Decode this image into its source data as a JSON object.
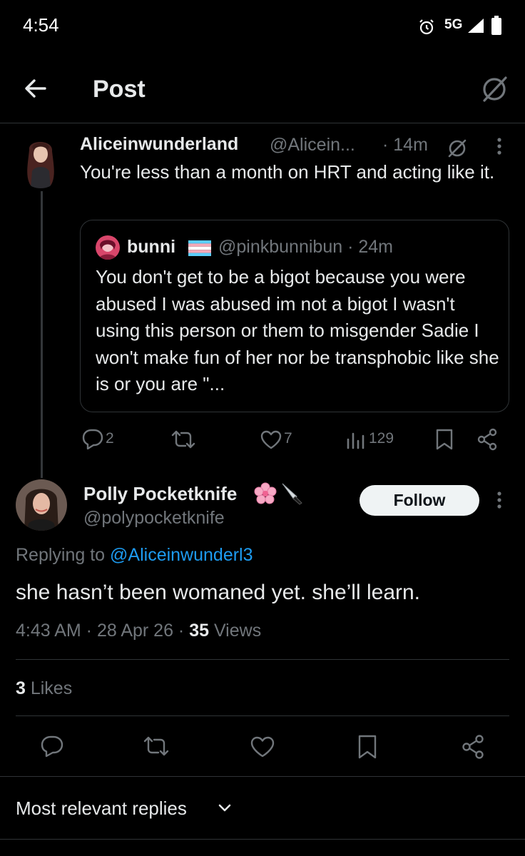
{
  "status_bar": {
    "time": "4:54",
    "network": "5G"
  },
  "header": {
    "title": "Post"
  },
  "parent_tweet": {
    "display_name": "Aliceinwunderland",
    "handle": "@Alicein...",
    "time": "· 14m",
    "text": "You're less than a month on HRT and acting like it.",
    "quote": {
      "display_name": "bunni",
      "handle": "@pinkbunnibun · 24m",
      "text": "You don't get to be a bigot because you were abused I was abused im not a bigot I wasn't using this person or them to misgender Sadie I won't make fun of her nor be transphobic like she is or you are \"..."
    },
    "stats": {
      "replies": "2",
      "reposts": "",
      "likes": "7",
      "views": "129"
    }
  },
  "reply_tweet": {
    "display_name": "Polly Pocketknife",
    "handle": "@polypocketknife",
    "follow_label": "Follow",
    "replying_prefix": "Replying to ",
    "replying_to": "@Aliceinwunderl3",
    "text": "she hasn’t been womaned yet. she’ll learn.",
    "timestamp": "4:43 AM · 28 Apr 26 · ",
    "views_count": "35",
    "views_label": " Views",
    "likes_count": "3",
    "likes_label": " Likes"
  },
  "footer": {
    "sort_label": "Most relevant replies"
  },
  "colors": {
    "background": "#000000",
    "text": "#e7e9ea",
    "muted": "#71767b",
    "accent": "#1d9bf0",
    "divider": "#2f3336"
  },
  "icons": [
    "back-arrow-icon",
    "grok-icon",
    "alarm-icon",
    "signal-icon",
    "battery-icon",
    "more-icon",
    "reply-icon",
    "repost-icon",
    "like-icon",
    "views-icon",
    "bookmark-icon",
    "share-icon",
    "chevron-down-icon"
  ]
}
